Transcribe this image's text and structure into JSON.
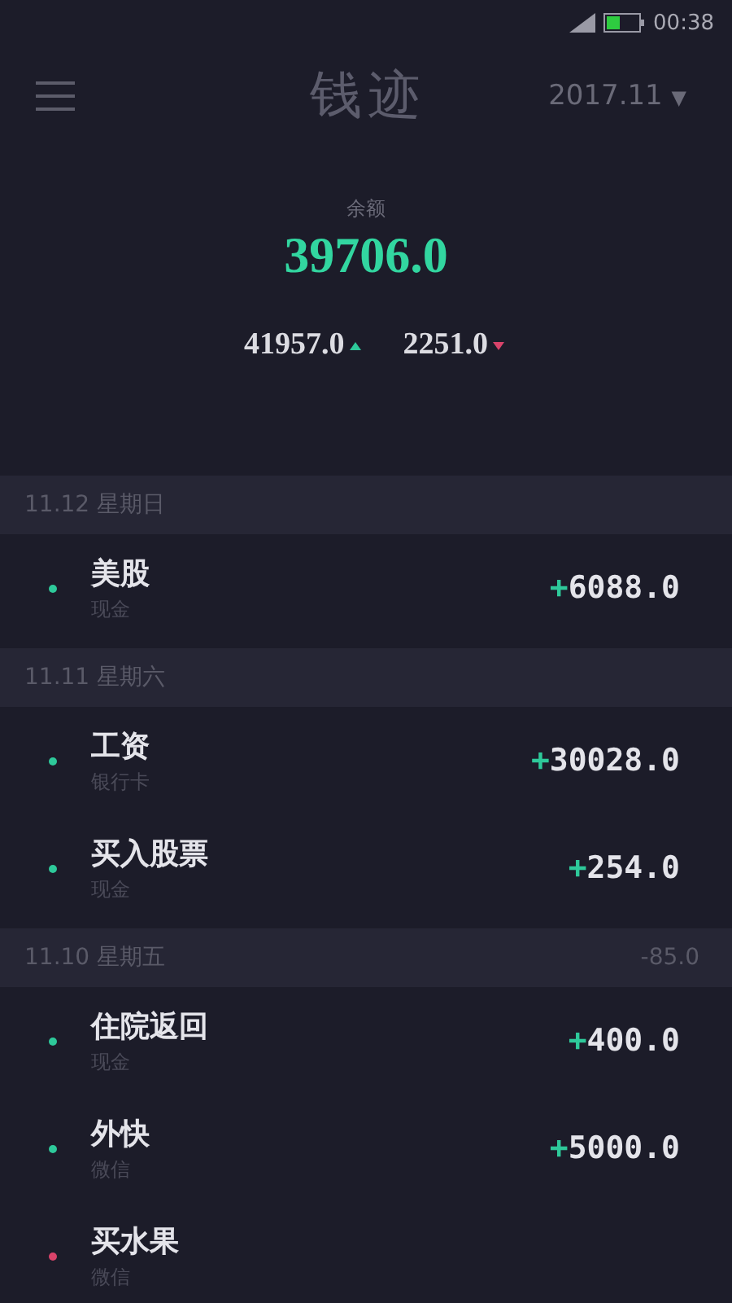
{
  "status_bar": {
    "time": "00:38"
  },
  "header": {
    "title": "钱迹",
    "month": "2017.11",
    "month_caret": "▼"
  },
  "summary": {
    "label": "余额",
    "balance": "39706.0",
    "income": "41957.0",
    "expense": "2251.0"
  },
  "days": [
    {
      "date": "11.12 星期日",
      "items": [
        {
          "name": "美股",
          "account": "现金",
          "sign": "+",
          "amount": "6088.0",
          "color": "#2ec99a"
        }
      ]
    },
    {
      "date": "11.11 星期六",
      "items": [
        {
          "name": "工资",
          "account": "银行卡",
          "sign": "+",
          "amount": "30028.0",
          "color": "#2ec99a"
        },
        {
          "name": "买入股票",
          "account": "现金",
          "sign": "+",
          "amount": "254.0",
          "color": "#2ec99a"
        }
      ]
    },
    {
      "date": "11.10 星期五",
      "total": "-85.0",
      "items": [
        {
          "name": "住院返回",
          "account": "现金",
          "sign": "+",
          "amount": "400.0",
          "color": "#2ec99a"
        },
        {
          "name": "外快",
          "account": "微信",
          "sign": "+",
          "amount": "5000.0",
          "color": "#2ec99a"
        },
        {
          "name": "买水果",
          "account": "微信",
          "color": "#d9436a"
        }
      ]
    }
  ]
}
